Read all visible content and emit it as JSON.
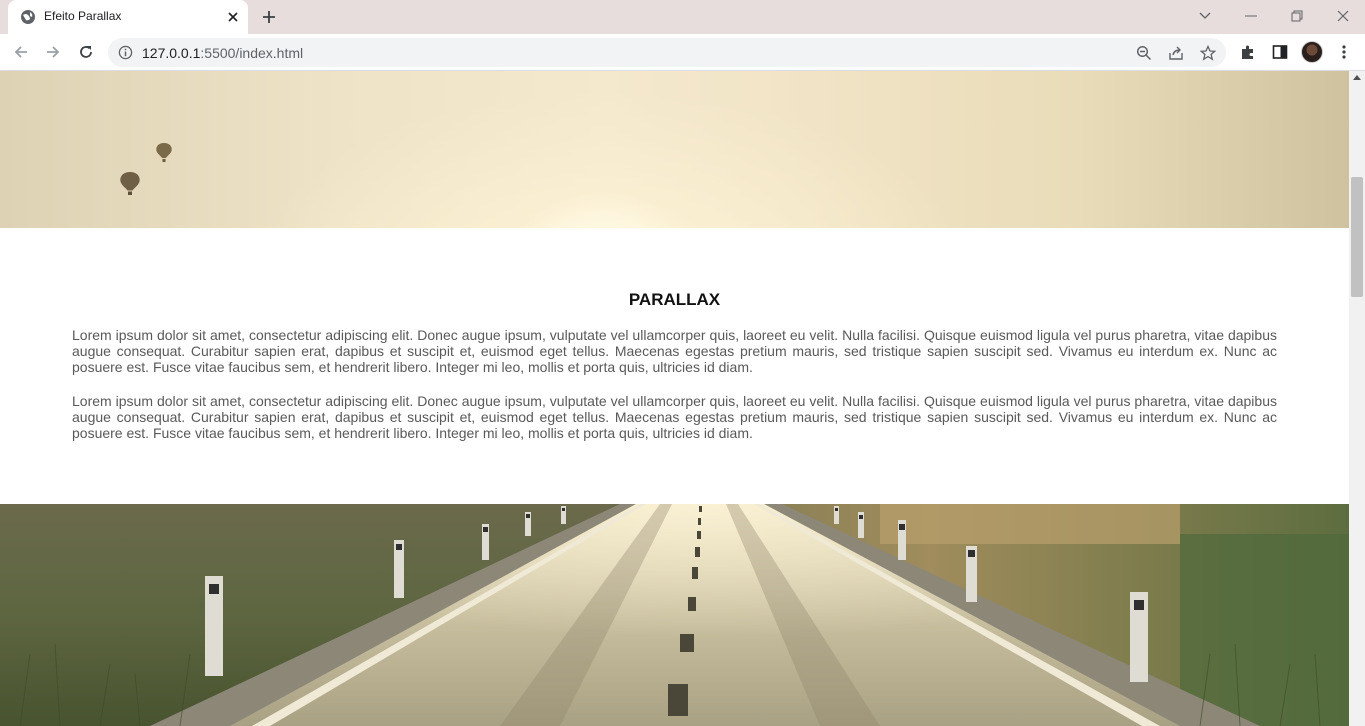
{
  "browser": {
    "tab": {
      "title": "Efeito Parallax",
      "favicon": "globe-icon"
    },
    "address": {
      "host": "127.0.0.1",
      "rest": ":5500/index.html"
    },
    "icons": [
      "back-icon",
      "forward-icon",
      "reload-icon",
      "info-icon",
      "zoom-out-icon",
      "share-icon",
      "star-icon",
      "extensions-icon",
      "side-panel-icon",
      "avatar",
      "menu-icon"
    ]
  },
  "page": {
    "heading": "PARALLAX",
    "paragraphs": [
      "Lorem ipsum dolor sit amet, consectetur adipiscing elit. Donec augue ipsum, vulputate vel ullamcorper quis, laoreet eu velit. Nulla facilisi. Quisque euismod ligula vel purus pharetra, vitae dapibus augue consequat. Curabitur sapien erat, dapibus et suscipit et, euismod eget tellus. Maecenas egestas pretium mauris, sed tristique sapien suscipit sed. Vivamus eu interdum ex. Nunc ac posuere est. Fusce vitae faucibus sem, et hendrerit libero. Integer mi leo, mollis et porta quis, ultricies id diam.",
      "Lorem ipsum dolor sit amet, consectetur adipiscing elit. Donec augue ipsum, vulputate vel ullamcorper quis, laoreet eu velit. Nulla facilisi. Quisque euismod ligula vel purus pharetra, vitae dapibus augue consequat. Curabitur sapien erat, dapibus et suscipit et, euismod eget tellus. Maecenas egestas pretium mauris, sed tristique sapien suscipit sed. Vivamus eu interdum ex. Nunc ac posuere est. Fusce vitae faucibus sem, et hendrerit libero. Integer mi leo, mollis et porta quis, ultricies id diam."
    ]
  },
  "colors": {
    "titlebar": "#e7dddd",
    "heading": "#111111",
    "body_text": "#595959",
    "sky": "#efe3c7"
  }
}
